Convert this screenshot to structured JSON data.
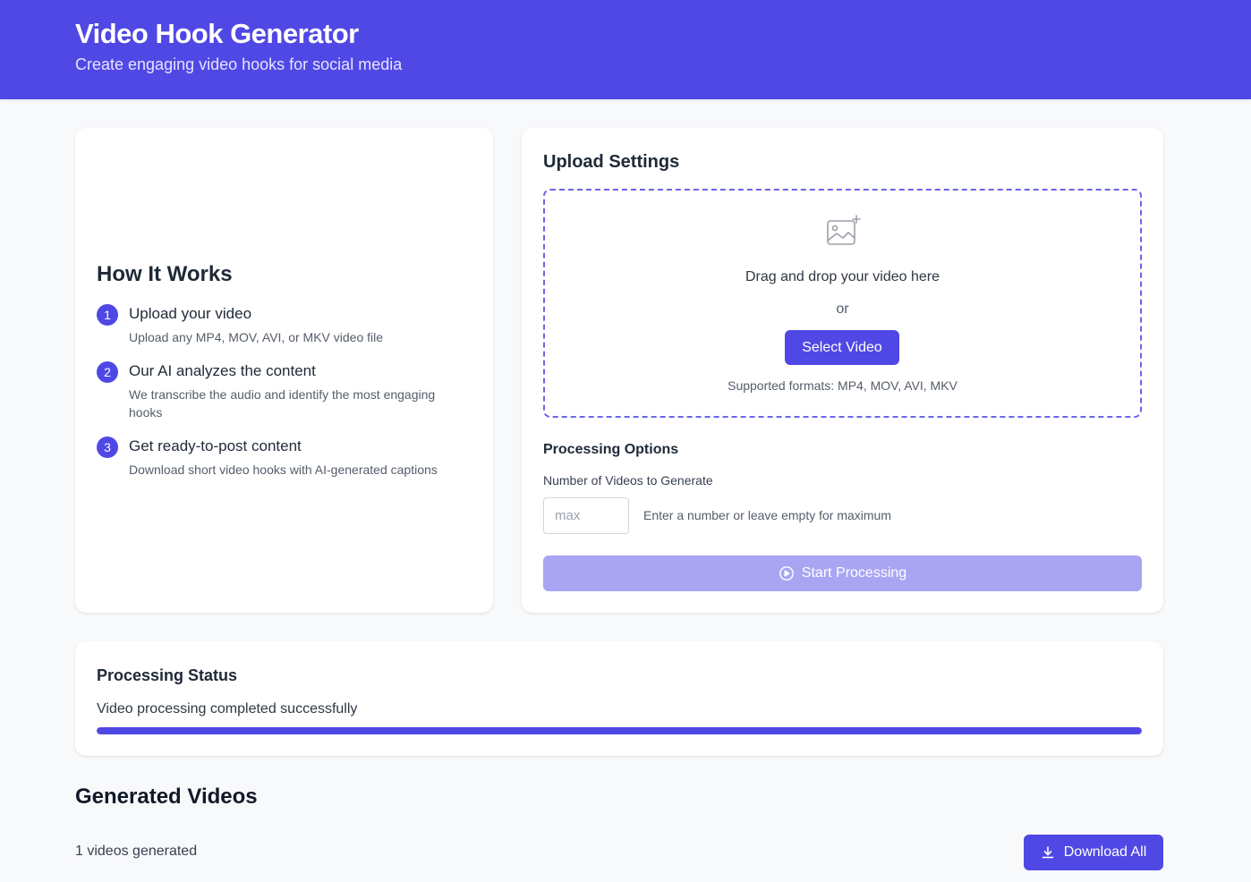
{
  "header": {
    "title": "Video Hook Generator",
    "subtitle": "Create engaging video hooks for social media"
  },
  "how_it_works": {
    "title": "How It Works",
    "steps": [
      {
        "number": "1",
        "title": "Upload your video",
        "description": "Upload any MP4, MOV, AVI, or MKV video file"
      },
      {
        "number": "2",
        "title": "Our AI analyzes the content",
        "description": "We transcribe the audio and identify the most engaging hooks"
      },
      {
        "number": "3",
        "title": "Get ready-to-post content",
        "description": "Download short video hooks with AI-generated captions"
      }
    ]
  },
  "upload": {
    "title": "Upload Settings",
    "drop_text": "Drag and drop your video here",
    "or_text": "or",
    "select_label": "Select Video",
    "formats": "Supported formats: MP4, MOV, AVI, MKV",
    "processing_title": "Processing Options",
    "num_label": "Number of Videos to Generate",
    "num_value": "",
    "num_placeholder": "max",
    "num_hint": "Enter a number or leave empty for maximum",
    "start_label": "Start Processing",
    "start_icon": "play-circle-icon",
    "upload_icon": "image-plus-icon"
  },
  "status": {
    "title": "Processing Status",
    "message": "Video processing completed successfully",
    "progress": 1.0
  },
  "generated": {
    "title": "Generated Videos",
    "count_text": "1 videos generated",
    "download_label": "Download All",
    "download_icon": "download-icon"
  },
  "colors": {
    "brand": "#5048e5",
    "disabled_button": "#a9a5f2",
    "page_background": "#f8f9fb"
  }
}
